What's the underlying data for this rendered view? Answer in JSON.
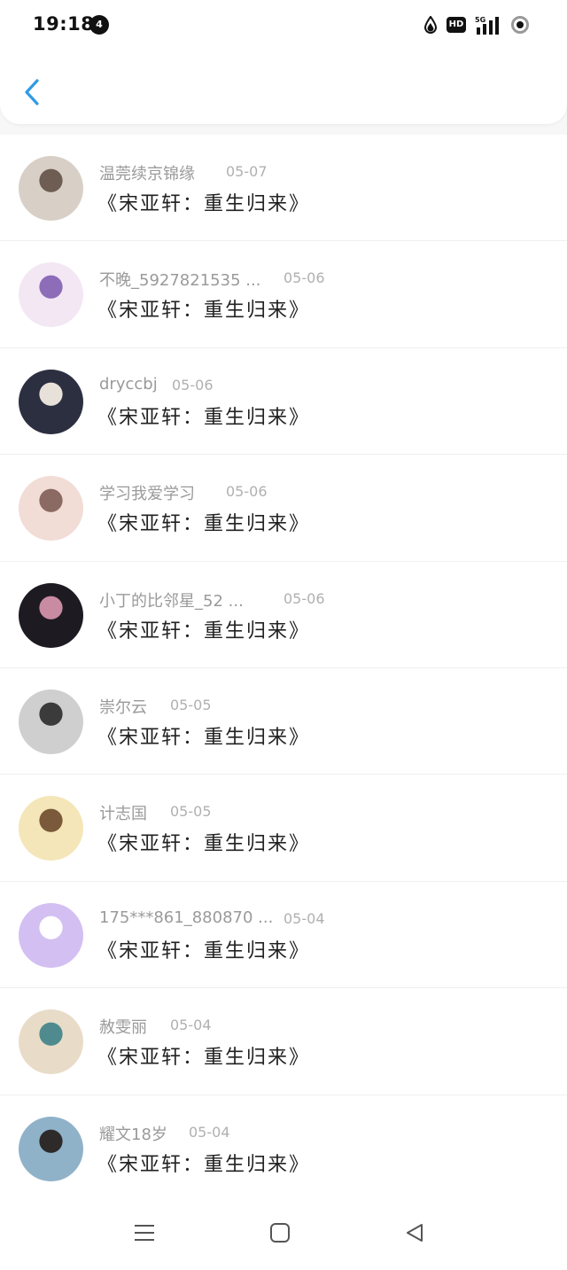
{
  "status_bar": {
    "time": "19:18",
    "notification_count": "4",
    "hd_label": "HD",
    "network_label": "5G"
  },
  "list": {
    "items": [
      {
        "username": "温莞续京锦缘",
        "date": "05-07",
        "title": "《宋亚轩：重生归来》",
        "avatar_colors": [
          "#d8cfc6",
          "#6e5d52"
        ]
      },
      {
        "username": "不晚_5927821535 ...",
        "date": "05-06",
        "title": "《宋亚轩：重生归来》",
        "avatar_colors": [
          "#f3e7f4",
          "#8d6cb8"
        ]
      },
      {
        "username": "dryccbj",
        "date": "05-06",
        "title": "《宋亚轩：重生归来》",
        "avatar_colors": [
          "#2c2f3f",
          "#e7e1da"
        ]
      },
      {
        "username": "学习我爱学习",
        "date": "05-06",
        "title": "《宋亚轩：重生归来》",
        "avatar_colors": [
          "#f2dcd6",
          "#8a6a62"
        ]
      },
      {
        "username": "小丁的比邻星_52 ...",
        "date": "05-06",
        "title": "《宋亚轩：重生归来》",
        "avatar_colors": [
          "#1d1a22",
          "#c98ba2"
        ]
      },
      {
        "username": "崇尔云",
        "date": "05-05",
        "title": "《宋亚轩：重生归来》",
        "avatar_colors": [
          "#cfcfcf",
          "#3b3b3b"
        ]
      },
      {
        "username": "计志国",
        "date": "05-05",
        "title": "《宋亚轩：重生归来》",
        "avatar_colors": [
          "#f4e6b8",
          "#7a5a3a"
        ]
      },
      {
        "username": "175***861_880870 ...",
        "date": "05-04",
        "title": "《宋亚轩：重生归来》",
        "avatar_colors": [
          "#d3bff2",
          "#ffffff"
        ]
      },
      {
        "username": "赦雯丽",
        "date": "05-04",
        "title": "《宋亚轩：重生归来》",
        "avatar_colors": [
          "#e8dcc8",
          "#4f8b8e"
        ]
      },
      {
        "username": "耀文18岁",
        "date": "05-04",
        "title": "《宋亚轩：重生归来》",
        "avatar_colors": [
          "#8fb2c9",
          "#2e2a2a"
        ]
      }
    ]
  },
  "colors": {
    "accent": "#2f9be6",
    "username": "#9a9a9a",
    "date": "#b0b0b0",
    "title": "#222222"
  },
  "icons": {
    "back": "chevron-left-icon",
    "nav_menu": "menu-icon",
    "nav_home": "square-home-icon",
    "nav_back": "triangle-back-icon"
  }
}
